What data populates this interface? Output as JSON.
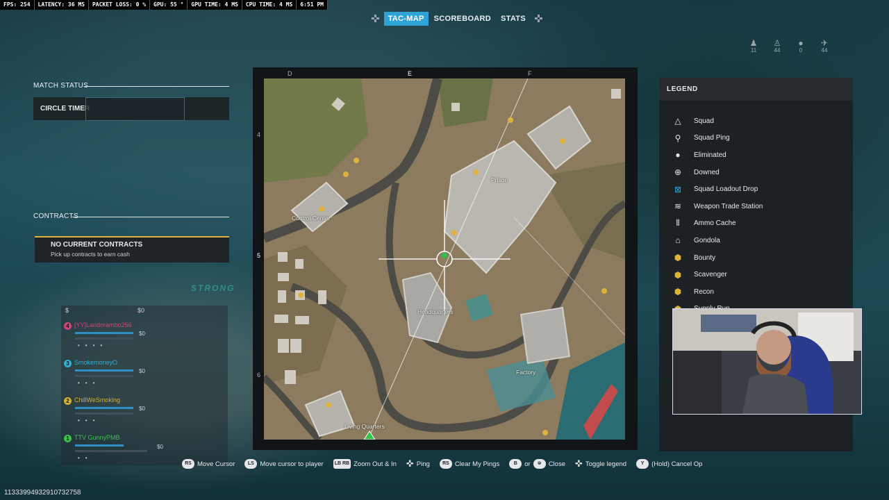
{
  "perf": {
    "fps": "FPS: 254",
    "latency": "LATENCY: 36 MS",
    "packet_loss": "PACKET LOSS: 0 %",
    "gpu": "GPU: 55 °",
    "gpu_time": "GPU TIME: 4 MS",
    "cpu_time": "CPU TIME: 4 MS",
    "clock": "6:51 PM"
  },
  "tabs": [
    "TAC-MAP",
    "SCOREBOARD",
    "STATS"
  ],
  "active_tab": "TAC-MAP",
  "team_counts": [
    "11",
    "44",
    "0",
    "44"
  ],
  "match_status": {
    "title": "MATCH STATUS",
    "circle_timer_label": "CIRCLE TIMER"
  },
  "contracts": {
    "title": "CONTRACTS",
    "card_title": "NO CURRENT CONTRACTS",
    "card_subtitle": "Pick up contracts to earn cash"
  },
  "banner_text": "STRONG",
  "squad": {
    "currency_symbol": "$",
    "team_cash": "$0",
    "members": [
      {
        "number": "4",
        "name": "[YY]Landorambo256",
        "cash": "$0",
        "color": "#d0447a"
      },
      {
        "number": "3",
        "name": "SmokemoneyO",
        "cash": "$0",
        "color": "#2fb0d4"
      },
      {
        "number": "2",
        "name": "ChillWeSmoking",
        "cash": "$0",
        "color": "#d6b12c"
      },
      {
        "number": "1",
        "name": "TTV GunnyPMB",
        "cash": "$0",
        "color": "#3ac24f"
      }
    ]
  },
  "map": {
    "columns": [
      "D",
      "E",
      "F"
    ],
    "rows": [
      "4",
      "5",
      "6"
    ],
    "locations": [
      "Prison",
      "Control Center",
      "Headquarters",
      "Factory",
      "Living Quarters"
    ]
  },
  "legend": {
    "title": "LEGEND",
    "items": [
      {
        "label": "Squad",
        "icon": "triangle-icon"
      },
      {
        "label": "Squad Ping",
        "icon": "pin-icon"
      },
      {
        "label": "Eliminated",
        "icon": "skull-icon"
      },
      {
        "label": "Downed",
        "icon": "downed-icon"
      },
      {
        "label": "Squad Loadout Drop",
        "icon": "loadout-drop-icon"
      },
      {
        "label": "Weapon Trade Station",
        "icon": "trade-station-icon"
      },
      {
        "label": "Ammo Cache",
        "icon": "ammo-icon"
      },
      {
        "label": "Gondola",
        "icon": "gondola-icon"
      },
      {
        "label": "Bounty",
        "icon": "bounty-icon"
      },
      {
        "label": "Scavenger",
        "icon": "scavenger-icon"
      },
      {
        "label": "Recon",
        "icon": "recon-icon"
      },
      {
        "label": "Supply Run",
        "icon": "supply-run-icon"
      }
    ]
  },
  "hints": [
    {
      "button": "RS",
      "label": "Move Cursor"
    },
    {
      "button": "LS",
      "label": "Move cursor to player"
    },
    {
      "button": "LB RB",
      "label": "Zoom Out & In"
    },
    {
      "button": "✜",
      "label": "Ping"
    },
    {
      "button": "RS",
      "label": "Clear My Pings"
    },
    {
      "button": "B",
      "label": "or"
    },
    {
      "button": "⊜",
      "label": "Close"
    },
    {
      "button": "✜",
      "label": "Toggle legend"
    },
    {
      "button": "Y",
      "label": "(Hold) Cancel Op"
    }
  ],
  "bottom_id": "11333994932910732758"
}
